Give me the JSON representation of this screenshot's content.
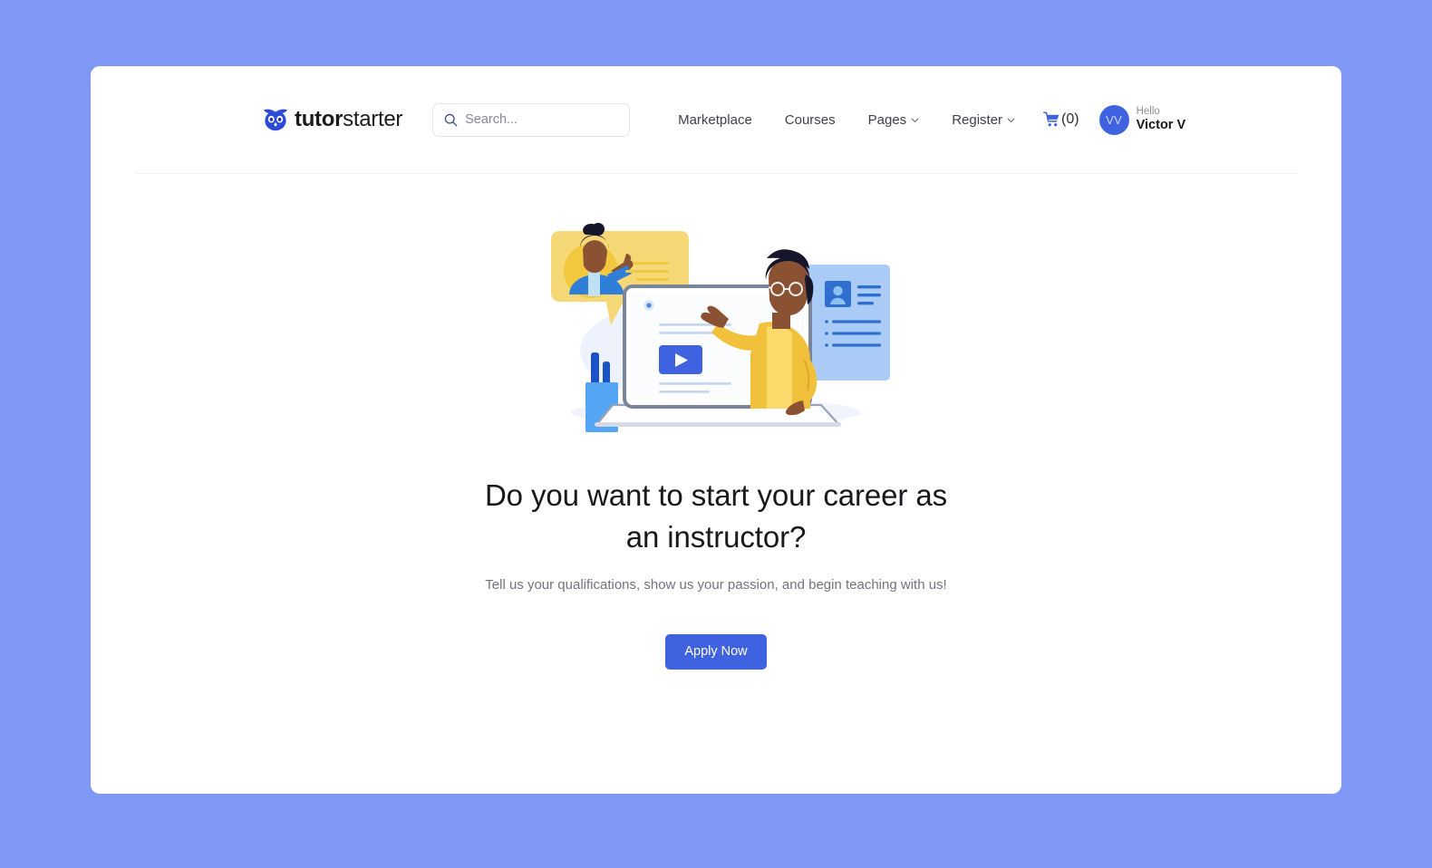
{
  "header": {
    "logo": {
      "icon": "owl-icon",
      "text_bold": "tutor",
      "text_light": "starter",
      "brand_color": "#2b4ad8"
    },
    "search": {
      "icon": "search-icon",
      "placeholder": "Search...",
      "value": ""
    },
    "nav": [
      {
        "label": "Marketplace",
        "has_dropdown": false
      },
      {
        "label": "Courses",
        "has_dropdown": false
      },
      {
        "label": "Pages",
        "has_dropdown": true
      },
      {
        "label": "Register",
        "has_dropdown": true
      }
    ],
    "cart": {
      "icon": "shopping-cart-icon",
      "count_label": "(0)",
      "count": 0
    },
    "user": {
      "avatar_initials": "VV",
      "greeting": "Hello",
      "name": "Victor V",
      "avatar_color": "#3f63e0"
    }
  },
  "hero": {
    "illustration": "instructor-teaching-illustration",
    "title_line1": "Do you want to start your career as",
    "title_line2": "an instructor?",
    "subtitle": "Tell us your qualifications, show us your passion, and begin teaching with us!",
    "cta_label": "Apply Now",
    "cta_color": "#3f63e0"
  },
  "theme": {
    "page_background": "#8098f5",
    "card_background": "#ffffff"
  }
}
